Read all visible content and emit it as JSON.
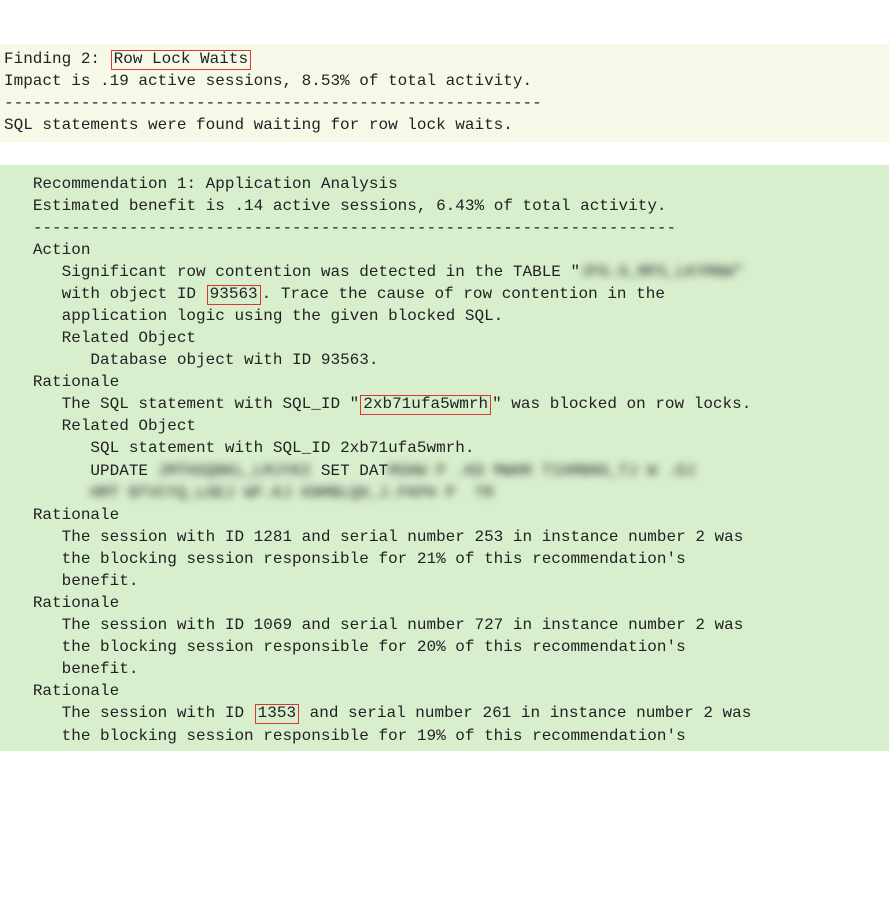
{
  "header": {
    "finding_prefix": "Finding 2: ",
    "finding_name": "Row Lock Waits",
    "impact_line": "Impact is .19 active sessions, 8.53% of total activity.",
    "separator": "--------------------------------------------------------",
    "description": "SQL statements were found waiting for row lock waits."
  },
  "rec": {
    "title": "Recommendation 1: Application Analysis",
    "benefit": "Estimated benefit is .14 active sessions, 6.43% of total activity.",
    "separator": "-------------------------------------------------------------------",
    "action_label": "Action",
    "action": {
      "l1a": "Significant row contention was detected in the TABLE \"",
      "redacted_table": "JFG.G_MPS_LKYMNW\"",
      "l2a": "with object ID ",
      "object_id": "93563",
      "l2b": ". Trace the cause of row contention in the",
      "l3": "application logic using the given blocked SQL.",
      "related_label": "Related Object",
      "related_text": "Database object with ID 93563."
    },
    "r1": {
      "label": "Rationale",
      "l1a": "The SQL statement with SQL_ID \"",
      "sql_id": "2xb71ufa5wmrh",
      "l1b": "\" was blocked on row locks.",
      "related_label": "Related Object",
      "related_text": "SQL statement with SQL_ID 2xb71ufa5wmrh.",
      "update_a": "UPDATE ",
      "redacted1": "JMTHSQNKL_LMJYKI",
      "set_kw": "SET DAT",
      "redacted2": "MSHW P .KD MWHR TIAMBNG_TJ W .DJ",
      "redacted3": "HMT BTVCYQ_LGEJ WF.KJ KNMBLQH_J.FKPH P  TR"
    },
    "r2": {
      "label": "Rationale",
      "l1": "The session with ID 1281 and serial number 253 in instance number 2 was",
      "l2": "the blocking session responsible for 21% of this recommendation's",
      "l3": "benefit."
    },
    "r3": {
      "label": "Rationale",
      "l1": "The session with ID 1069 and serial number 727 in instance number 2 was",
      "l2": "the blocking session responsible for 20% of this recommendation's",
      "l3": "benefit."
    },
    "r4": {
      "label": "Rationale",
      "l1a": "The session with ID ",
      "session_id": "1353",
      "l1b": " and serial number 261 in instance number 2 was",
      "l2": "the blocking session responsible for 19% of this recommendation's"
    }
  }
}
